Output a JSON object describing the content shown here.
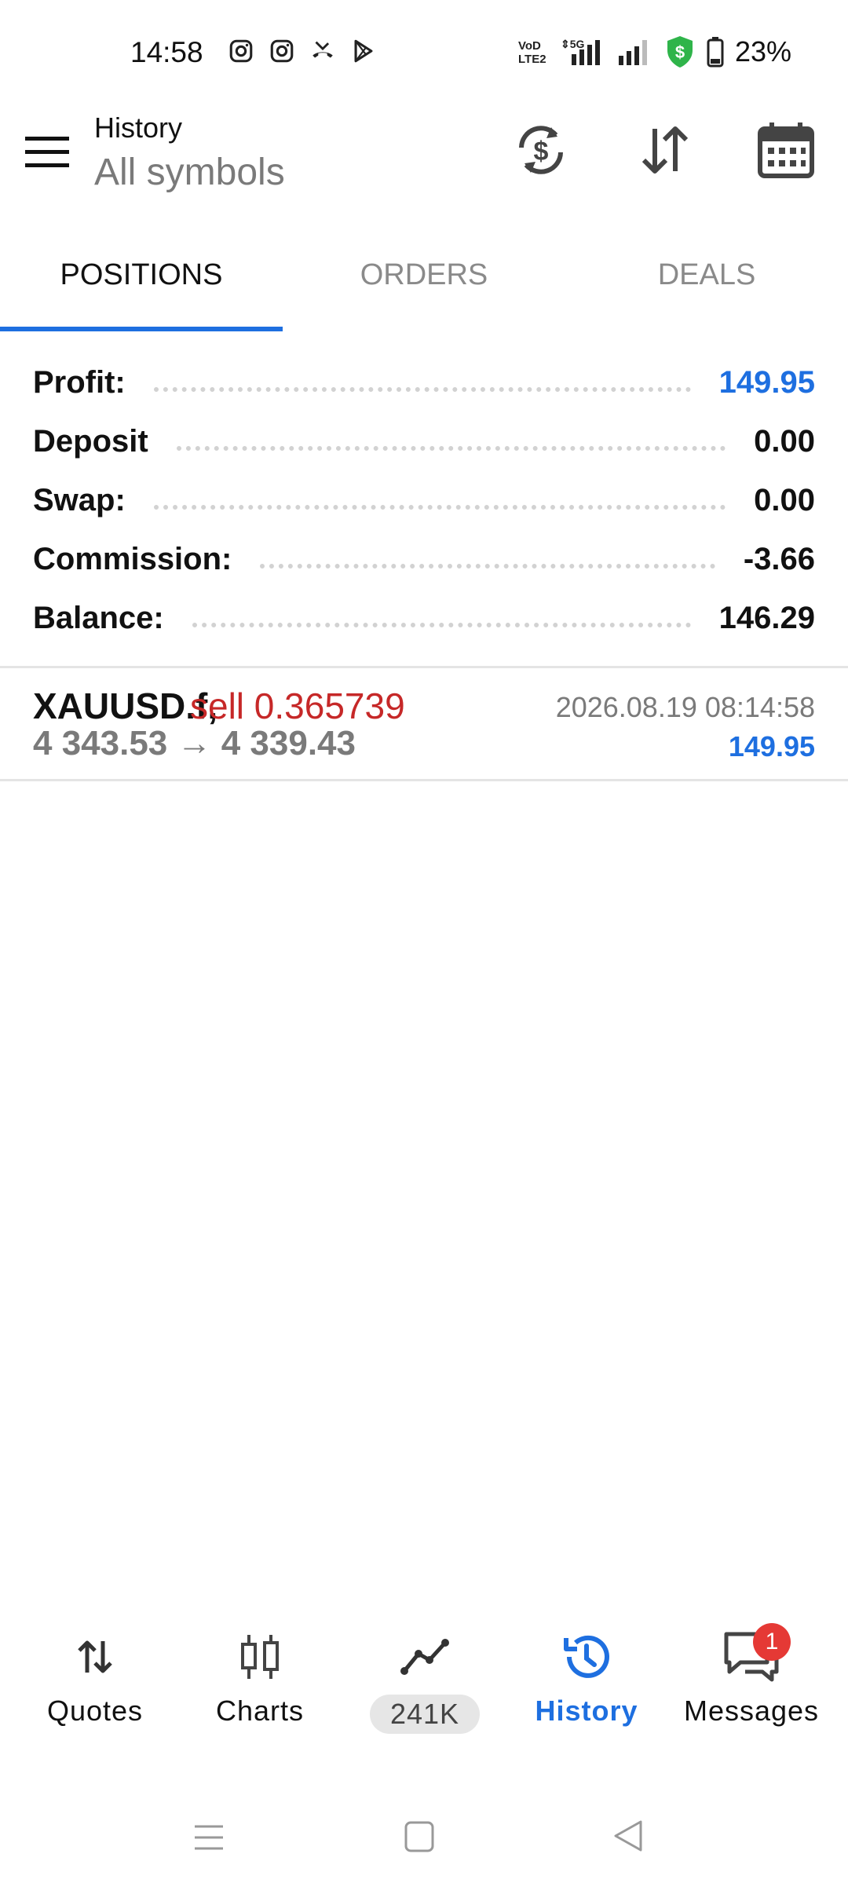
{
  "status_bar": {
    "time": "14:58",
    "battery": "23%"
  },
  "header": {
    "title": "History",
    "subtitle": "All symbols"
  },
  "tabs": [
    {
      "label": "POSITIONS",
      "active": true
    },
    {
      "label": "ORDERS",
      "active": false
    },
    {
      "label": "DEALS",
      "active": false
    }
  ],
  "summary": {
    "profit_label": "Profit:",
    "profit_value": "149.95",
    "deposit_label": "Deposit",
    "deposit_value": "0.00",
    "swap_label": "Swap:",
    "swap_value": "0.00",
    "commission_label": "Commission:",
    "commission_value": "-3.66",
    "balance_label": "Balance:",
    "balance_value": "146.29"
  },
  "positions": [
    {
      "symbol": "XAUUSD.f,",
      "side": "sell 0.365739",
      "prices": "4 343.53 → 4 339.43",
      "datetime": "2026.08.19 08:14:58",
      "profit": "149.95"
    }
  ],
  "bottom_nav": {
    "quotes": "Quotes",
    "charts": "Charts",
    "community": "241K",
    "history": "History",
    "messages": "Messages",
    "messages_badge": "1"
  },
  "colors": {
    "accent": "#1e6fe0",
    "sell": "#c62828",
    "badge": "#e53935"
  }
}
